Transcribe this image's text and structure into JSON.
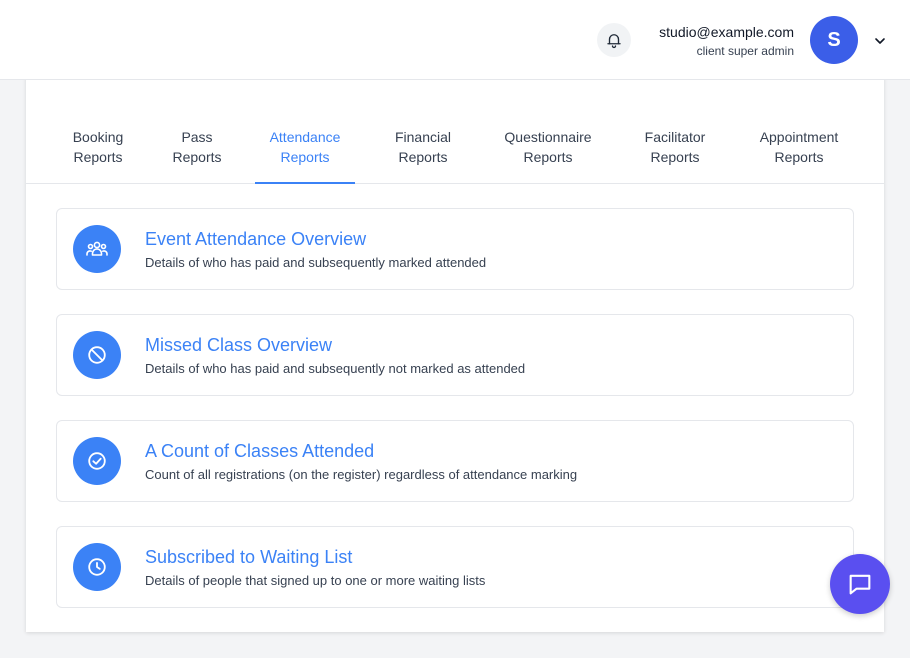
{
  "header": {
    "user_email": "studio@example.com",
    "user_role": "client super admin",
    "avatar_initial": "S"
  },
  "tabs": [
    {
      "line1": "Booking",
      "line2": "Reports",
      "active": false
    },
    {
      "line1": "Pass",
      "line2": "Reports",
      "active": false
    },
    {
      "line1": "Attendance",
      "line2": "Reports",
      "active": true
    },
    {
      "line1": "Financial",
      "line2": "Reports",
      "active": false
    },
    {
      "line1": "Questionnaire",
      "line2": "Reports",
      "active": false
    },
    {
      "line1": "Facilitator",
      "line2": "Reports",
      "active": false
    },
    {
      "line1": "Appointment",
      "line2": "Reports",
      "active": false
    }
  ],
  "reports": [
    {
      "icon": "users-group-icon",
      "title": "Event Attendance Overview",
      "description": "Details of who has paid and subsequently marked attended"
    },
    {
      "icon": "ban-icon",
      "title": "Missed Class Overview",
      "description": "Details of who has paid and subsequently not marked as attended"
    },
    {
      "icon": "check-circle-icon",
      "title": "A Count of Classes Attended",
      "description": "Count of all registrations (on the register) regardless of attendance marking"
    },
    {
      "icon": "clock-icon",
      "title": "Subscribed to Waiting List",
      "description": "Details of people that signed up to one or more waiting lists"
    }
  ],
  "colors": {
    "accent": "#3b82f6",
    "avatar": "#3b5ee8",
    "chat_button": "#5a4ff0"
  }
}
